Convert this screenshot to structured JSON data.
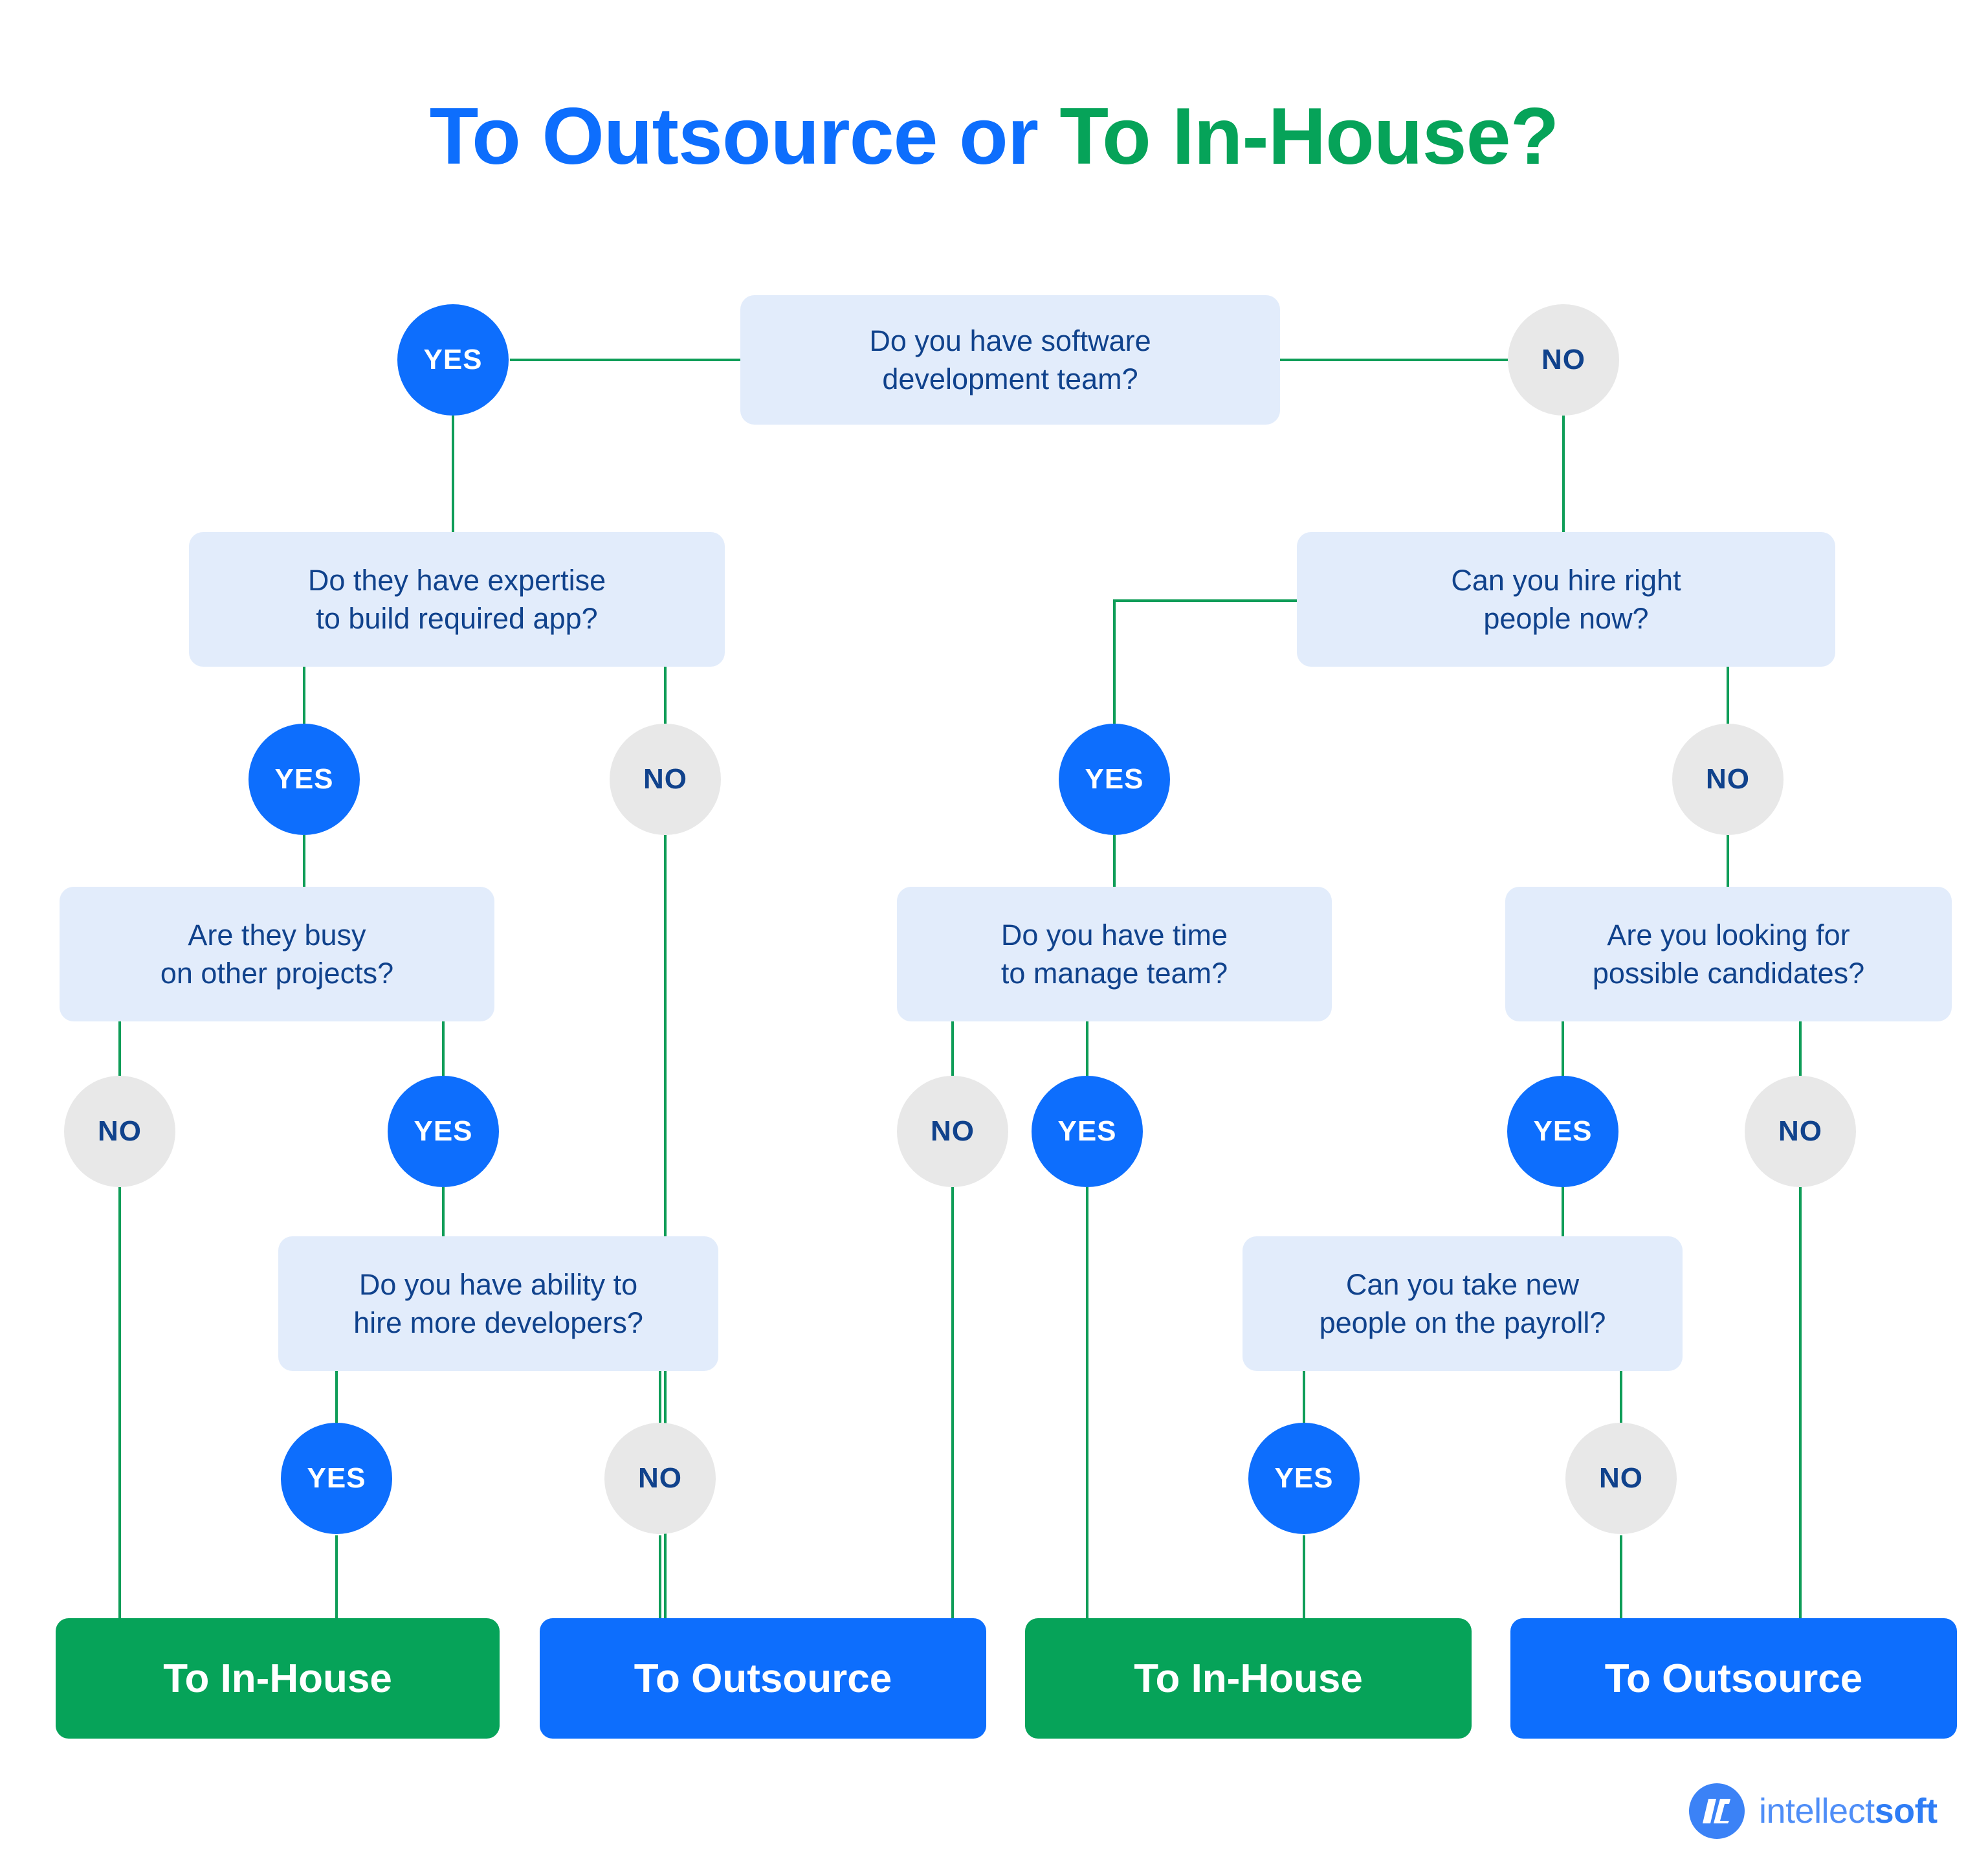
{
  "title": {
    "part1": "To Outsource or ",
    "part2": "To In-House?",
    "color_blue": "#0d6efd",
    "color_green": "#06a359"
  },
  "colors": {
    "background": "#ffffff",
    "question_box": "#e2ecfb",
    "question_text": "#10428c",
    "yes_circle": "#0d6efd",
    "no_circle": "#e8e8e8",
    "connector_line": "#0f9d58",
    "result_inhouse": "#06a359",
    "result_outsource": "#0d6efd",
    "logo_blue": "#3b82f6"
  },
  "questions": {
    "q1": {
      "line1": "Do you have software",
      "line2": "development team?"
    },
    "q2": {
      "line1": "Do they have expertise",
      "line2": "to build required app?"
    },
    "q3": {
      "line1": "Can you hire right",
      "line2": "people now?"
    },
    "q4": {
      "line1": "Are they busy",
      "line2": "on other projects?"
    },
    "q5": {
      "line1": "Do you have time",
      "line2": "to manage team?"
    },
    "q6": {
      "line1": "Are you looking for",
      "line2": "possible candidates?"
    },
    "q7": {
      "line1": "Do you have ability to",
      "line2": "hire more developers?"
    },
    "q8": {
      "line1": "Can you take new",
      "line2": "people on the payroll?"
    }
  },
  "labels": {
    "yes": "YES",
    "no": "NO"
  },
  "nodes": {
    "n1_yes": "YES",
    "n1_no": "NO",
    "n2_yes": "YES",
    "n2_no": "NO",
    "n3_yes": "YES",
    "n3_no": "NO",
    "n4_no": "NO",
    "n4_yes": "YES",
    "n5_no": "NO",
    "n5_yes": "YES",
    "n6_yes": "YES",
    "n6_no": "NO",
    "n7_yes": "YES",
    "n7_no": "NO",
    "n8_yes": "YES",
    "n8_no": "NO"
  },
  "results": {
    "r1": "To In-House",
    "r2": "To Outsource",
    "r3": "To In-House",
    "r4": "To Outsource"
  },
  "logo": {
    "name_light": "intellect",
    "name_bold": "soft"
  },
  "chart_data": {
    "type": "flowchart",
    "title": "To Outsource or To In-House?",
    "nodes": [
      {
        "id": "q1",
        "kind": "question",
        "text": "Do you have software development team?"
      },
      {
        "id": "q2",
        "kind": "question",
        "text": "Do they have expertise to build required app?"
      },
      {
        "id": "q3",
        "kind": "question",
        "text": "Can you hire right people now?"
      },
      {
        "id": "q4",
        "kind": "question",
        "text": "Are they busy on other projects?"
      },
      {
        "id": "q5",
        "kind": "question",
        "text": "Do you have time to manage team?"
      },
      {
        "id": "q6",
        "kind": "question",
        "text": "Are you looking for possible candidates?"
      },
      {
        "id": "q7",
        "kind": "question",
        "text": "Do you have ability to hire more developers?"
      },
      {
        "id": "q8",
        "kind": "question",
        "text": "Can you take new people on the payroll?"
      },
      {
        "id": "r1",
        "kind": "result",
        "text": "To In-House"
      },
      {
        "id": "r2",
        "kind": "result",
        "text": "To Outsource"
      },
      {
        "id": "r3",
        "kind": "result",
        "text": "To In-House"
      },
      {
        "id": "r4",
        "kind": "result",
        "text": "To Outsource"
      }
    ],
    "edges": [
      {
        "from": "q1",
        "to": "q2",
        "label": "YES"
      },
      {
        "from": "q1",
        "to": "q3",
        "label": "NO"
      },
      {
        "from": "q2",
        "to": "q4",
        "label": "YES"
      },
      {
        "from": "q2",
        "to": "r2",
        "label": "NO"
      },
      {
        "from": "q4",
        "to": "r1",
        "label": "NO"
      },
      {
        "from": "q4",
        "to": "q7",
        "label": "YES"
      },
      {
        "from": "q7",
        "to": "r1",
        "label": "YES"
      },
      {
        "from": "q7",
        "to": "r2",
        "label": "NO"
      },
      {
        "from": "q3",
        "to": "q5",
        "label": "YES"
      },
      {
        "from": "q3",
        "to": "q6",
        "label": "NO"
      },
      {
        "from": "q5",
        "to": "r3",
        "label": "NO"
      },
      {
        "from": "q5",
        "to": "r3",
        "label": "YES"
      },
      {
        "from": "q6",
        "to": "q8",
        "label": "YES"
      },
      {
        "from": "q6",
        "to": "r4",
        "label": "NO"
      },
      {
        "from": "q8",
        "to": "r3",
        "label": "YES"
      },
      {
        "from": "q8",
        "to": "r4",
        "label": "NO"
      }
    ]
  }
}
